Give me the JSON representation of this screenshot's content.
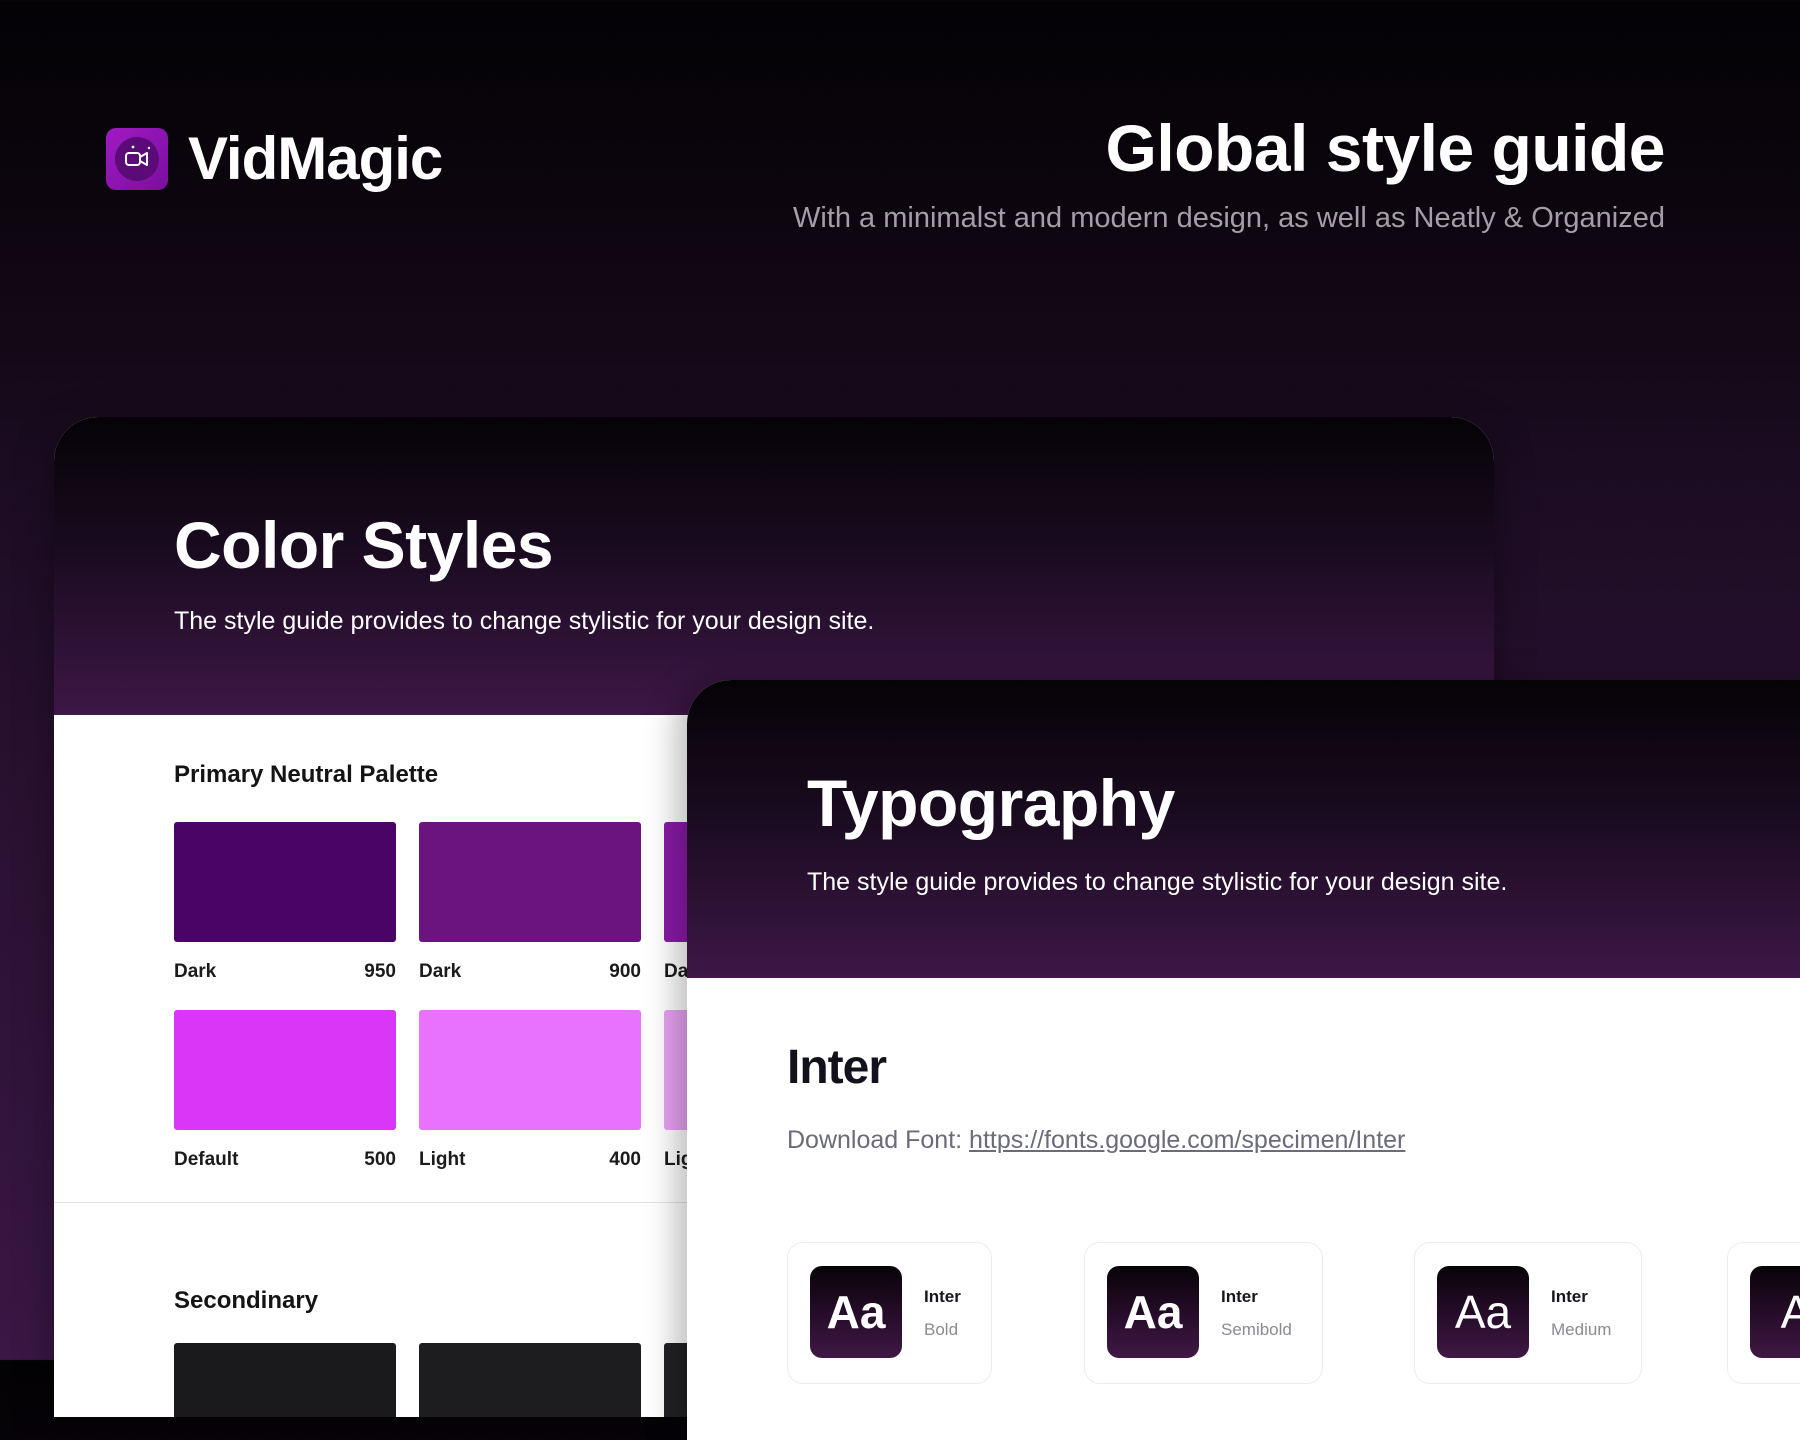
{
  "brand": {
    "name": "VidMagic",
    "logo_icon": "ai-video-icon",
    "accent": "#9b17c2"
  },
  "hero": {
    "title": "Global style guide",
    "subtitle": "With a minimalst and modern design, as well as Neatly & Organized"
  },
  "color_styles": {
    "title": "Color Styles",
    "description": "The style guide provides to change stylistic for your design site.",
    "primary": {
      "label": "Primary Neutral Palette",
      "swatches": [
        {
          "name": "Dark",
          "value": "950",
          "color": "#4a0466"
        },
        {
          "name": "Dark",
          "value": "900",
          "color": "#6b1480"
        },
        {
          "name": "Da",
          "value": "",
          "color": "#8a1aa8"
        },
        {
          "name": "Default",
          "value": "500",
          "color": "#d936f7"
        },
        {
          "name": "Light",
          "value": "400",
          "color": "#e872fb"
        },
        {
          "name": "Lig",
          "value": "",
          "color": "#e8a2f3"
        }
      ]
    },
    "secondary": {
      "label": "Secondinary",
      "swatches": [
        {
          "color": "#1a1a1c"
        },
        {
          "color": "#1d1d20"
        },
        {
          "color": "#222226"
        }
      ]
    }
  },
  "typography": {
    "title": "Typography",
    "description": "The style guide provides to change stylistic for your design site.",
    "font": {
      "name": "Inter",
      "download_label": "Download Font: ",
      "download_url": "https://fonts.google.com/specimen/Inter",
      "weights": [
        {
          "sample": "Aa",
          "family": "Inter",
          "weight": "Bold"
        },
        {
          "sample": "Aa",
          "family": "Inter",
          "weight": "Semibold"
        },
        {
          "sample": "Aa",
          "family": "Inter",
          "weight": "Medium"
        },
        {
          "sample": "A",
          "family": "",
          "weight": ""
        }
      ]
    }
  }
}
